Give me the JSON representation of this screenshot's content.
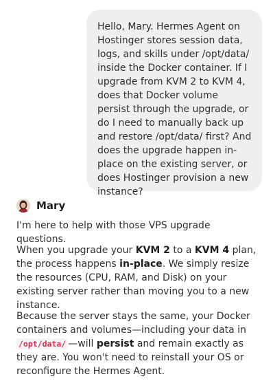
{
  "user_message": {
    "text": "Hello, Mary. Hermes Agent on Hostinger stores session data, logs, and skills under /opt/data/ inside the Docker container. If I upgrade from KVM 2 to KVM 4, does that Docker volume persist through the upgrade, or do I need to manually back up and restore /opt/data/ first? And does the upgrade happen in-place on the existing server, or does Hostinger provision a new instance?"
  },
  "agent": {
    "name": "Mary",
    "avatar_icon": "agent-avatar"
  },
  "agent_message": {
    "p1": "I'm here to help with those VPS upgrade questions.",
    "p2": {
      "t1": "When you upgrade your ",
      "b1": "KVM 2",
      "t2": " to a ",
      "b2": "KVM 4",
      "t3": " plan, the process happens ",
      "b3": "in-place",
      "t4": ". We simply resize the resources (CPU, RAM, and Disk) on your existing server rather than moving you to a new instance."
    },
    "p3": {
      "t1": "Because the server stays the same, your Docker containers and volumes—including your data in ",
      "code1": "/opt/data/",
      "t2": "—will ",
      "b1": "persist",
      "t3": " and remain exactly as they are. You won't need to reinstall your OS or reconfigure the Hermes Agent."
    }
  }
}
